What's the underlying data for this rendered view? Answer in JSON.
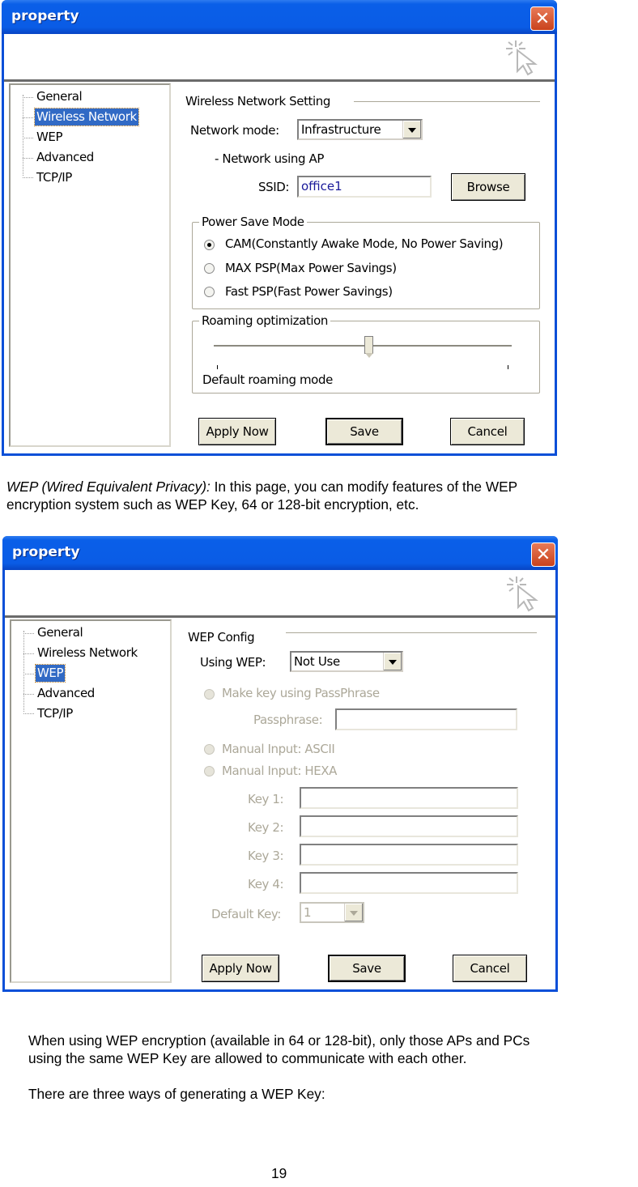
{
  "dialog1": {
    "title": "property",
    "tree": [
      "General",
      "Wireless Network",
      "WEP",
      "Advanced",
      "TCP/IP"
    ],
    "selected": "Wireless Network",
    "section_title": "Wireless Network Setting",
    "network_mode_label": "Network mode:",
    "network_mode_value": "Infrastructure",
    "network_note": "- Network using AP",
    "ssid_label": "SSID:",
    "ssid_value": "office1",
    "browse_label": "Browse",
    "power_save": {
      "title": "Power Save Mode",
      "options": [
        {
          "label": "CAM(Constantly Awake Mode, No Power Saving)",
          "selected": true
        },
        {
          "label": "MAX PSP(Max Power Savings)",
          "selected": false
        },
        {
          "label": "Fast PSP(Fast Power Savings)",
          "selected": false
        }
      ]
    },
    "roaming": {
      "title": "Roaming optimization",
      "slider_value_fraction": 0.52,
      "caption": "Default roaming mode"
    },
    "buttons": {
      "apply": "Apply Now",
      "save": "Save",
      "cancel": "Cancel"
    }
  },
  "para1": {
    "italic_lead": "WEP (Wired Equivalent Privacy):",
    "line1_rest": " In this page, you can modify features of the WEP",
    "line2": "encryption system such as WEP Key, 64 or 128-bit encryption, etc."
  },
  "dialog2": {
    "title": "property",
    "tree": [
      "General",
      "Wireless Network",
      "WEP",
      "Advanced",
      "TCP/IP"
    ],
    "selected": "WEP",
    "section_title": "WEP Config",
    "using_wep_label": "Using WEP:",
    "using_wep_value": "Not Use",
    "passphrase_option": "Make key using PassPhrase",
    "passphrase_label": "Passphrase:",
    "passphrase_value": "",
    "manual_ascii": "Manual Input:  ASCII",
    "manual_hexa": "Manual Input:  HEXA",
    "keys": [
      {
        "label": "Key 1:",
        "value": ""
      },
      {
        "label": "Key 2:",
        "value": ""
      },
      {
        "label": "Key 3:",
        "value": ""
      },
      {
        "label": "Key 4:",
        "value": ""
      }
    ],
    "default_key_label": "Default Key:",
    "default_key_value": "1",
    "buttons": {
      "apply": "Apply Now",
      "save": "Save",
      "cancel": "Cancel"
    }
  },
  "para2": {
    "line1": "When using WEP encryption (available in 64 or 128-bit), only those APs and PCs",
    "line2": "using the same WEP Key are allowed to communicate with each other.",
    "line3": "There are three ways of generating a WEP Key:"
  },
  "page_number": "19"
}
